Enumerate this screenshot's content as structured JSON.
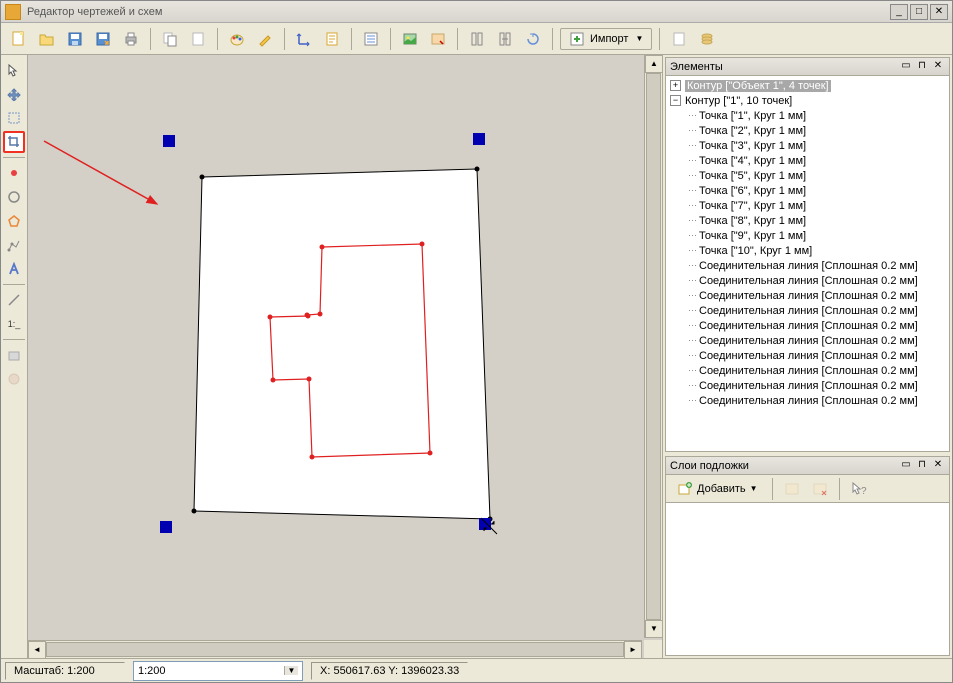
{
  "title": "Редактор чертежей и схем",
  "toolbar": {
    "import_label": "Импорт"
  },
  "elements_panel": {
    "title": "Элементы",
    "tree": [
      {
        "level": 0,
        "expand": "+",
        "label": "Контур [\"Объект 1\", 4 точек]",
        "selected": true
      },
      {
        "level": 0,
        "expand": "-",
        "label": "Контур [\"1\", 10 точек]"
      },
      {
        "level": 1,
        "label": "Точка [\"1\", Круг 1 мм]"
      },
      {
        "level": 1,
        "label": "Точка [\"2\", Круг 1 мм]"
      },
      {
        "level": 1,
        "label": "Точка [\"3\", Круг 1 мм]"
      },
      {
        "level": 1,
        "label": "Точка [\"4\", Круг 1 мм]"
      },
      {
        "level": 1,
        "label": "Точка [\"5\", Круг 1 мм]"
      },
      {
        "level": 1,
        "label": "Точка [\"6\", Круг 1 мм]"
      },
      {
        "level": 1,
        "label": "Точка [\"7\", Круг 1 мм]"
      },
      {
        "level": 1,
        "label": "Точка [\"8\", Круг 1 мм]"
      },
      {
        "level": 1,
        "label": "Точка [\"9\", Круг 1 мм]"
      },
      {
        "level": 1,
        "label": "Точка [\"10\", Круг 1 мм]"
      },
      {
        "level": 1,
        "label": "Соединительная линия [Сплошная 0.2 мм]"
      },
      {
        "level": 1,
        "label": "Соединительная линия [Сплошная 0.2 мм]"
      },
      {
        "level": 1,
        "label": "Соединительная линия [Сплошная 0.2 мм]"
      },
      {
        "level": 1,
        "label": "Соединительная линия [Сплошная 0.2 мм]"
      },
      {
        "level": 1,
        "label": "Соединительная линия [Сплошная 0.2 мм]"
      },
      {
        "level": 1,
        "label": "Соединительная линия [Сплошная 0.2 мм]"
      },
      {
        "level": 1,
        "label": "Соединительная линия [Сплошная 0.2 мм]"
      },
      {
        "level": 1,
        "label": "Соединительная линия [Сплошная 0.2 мм]"
      },
      {
        "level": 1,
        "label": "Соединительная линия [Сплошная 0.2 мм]"
      },
      {
        "level": 1,
        "label": "Соединительная линия [Сплошная 0.2 мм]"
      }
    ]
  },
  "layers_panel": {
    "title": "Слои подложки",
    "add_label": "Добавить"
  },
  "statusbar": {
    "scale_label": "Масштаб: 1:200",
    "scale_combo": "1:200",
    "coords": "X: 550617.63 Y: 1396023.33"
  }
}
